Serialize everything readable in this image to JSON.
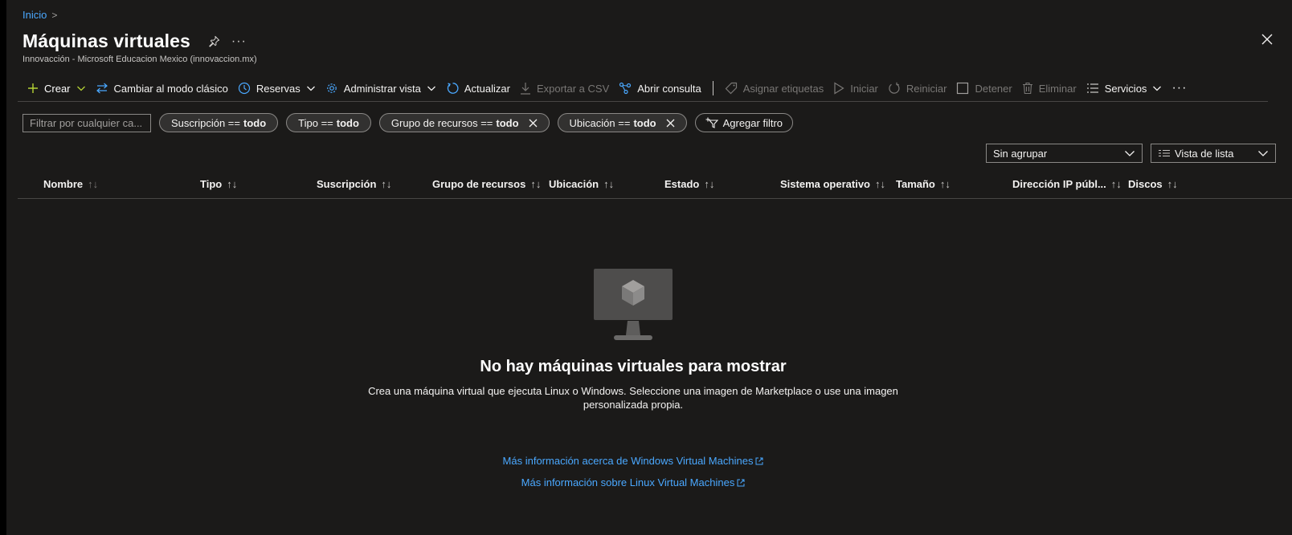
{
  "breadcrumb": {
    "home": "Inicio",
    "separator": ">"
  },
  "header": {
    "title": "Máquinas virtuales",
    "subtitle": "Innovacción - Microsoft Educacion Mexico (innovaccion.mx)",
    "more": "···"
  },
  "toolbar": {
    "create": "Crear",
    "classic": "Cambiar al modo clásico",
    "reservations": "Reservas",
    "manage_view": "Administrar vista",
    "refresh": "Actualizar",
    "export_csv": "Exportar a CSV",
    "open_query": "Abrir consulta",
    "assign_tags": "Asignar etiquetas",
    "start": "Iniciar",
    "restart": "Reiniciar",
    "stop": "Detener",
    "delete": "Eliminar",
    "services": "Servicios",
    "more": "···"
  },
  "filters": {
    "search_placeholder": "Filtrar por cualquier ca...",
    "pills": [
      {
        "label": "Suscripción ==",
        "value": "todo"
      },
      {
        "label": "Tipo ==",
        "value": "todo"
      },
      {
        "label": "Grupo de recursos ==",
        "value": "todo"
      },
      {
        "label": "Ubicación ==",
        "value": "todo"
      }
    ],
    "add_filter": "Agregar filtro"
  },
  "grouping": {
    "group_by": "Sin agrupar",
    "view": "Vista de lista"
  },
  "table": {
    "sort_glyph": "↑↓",
    "columns": [
      "Nombre",
      "Tipo",
      "Suscripción",
      "Grupo de recursos",
      "Ubicación",
      "Estado",
      "Sistema operativo",
      "Tamaño",
      "Dirección IP públ...",
      "Discos"
    ]
  },
  "empty_state": {
    "title": "No hay máquinas virtuales para mostrar",
    "description": "Crea una máquina virtual que ejecuta Linux o Windows. Seleccione una imagen de Marketplace o use una imagen personalizada propia.",
    "link_windows": "Más información acerca de Windows Virtual Machines",
    "link_linux": "Más información sobre Linux Virtual Machines"
  },
  "colors": {
    "background": "#1b1a19",
    "link": "#4aa8ff",
    "create_accent": "#b5d334",
    "text": "#f3f2f1",
    "disabled": "#797775"
  },
  "icons": [
    "pin-icon",
    "close-icon",
    "plus-icon",
    "chevron-down-icon",
    "switch-icon",
    "clock-icon",
    "gear-icon",
    "refresh-icon",
    "download-icon",
    "query-icon",
    "tag-icon",
    "play-icon",
    "restart-icon",
    "stop-icon",
    "trash-icon",
    "list-icon",
    "filter-add-icon",
    "monitor-icon",
    "external-link-icon"
  ]
}
